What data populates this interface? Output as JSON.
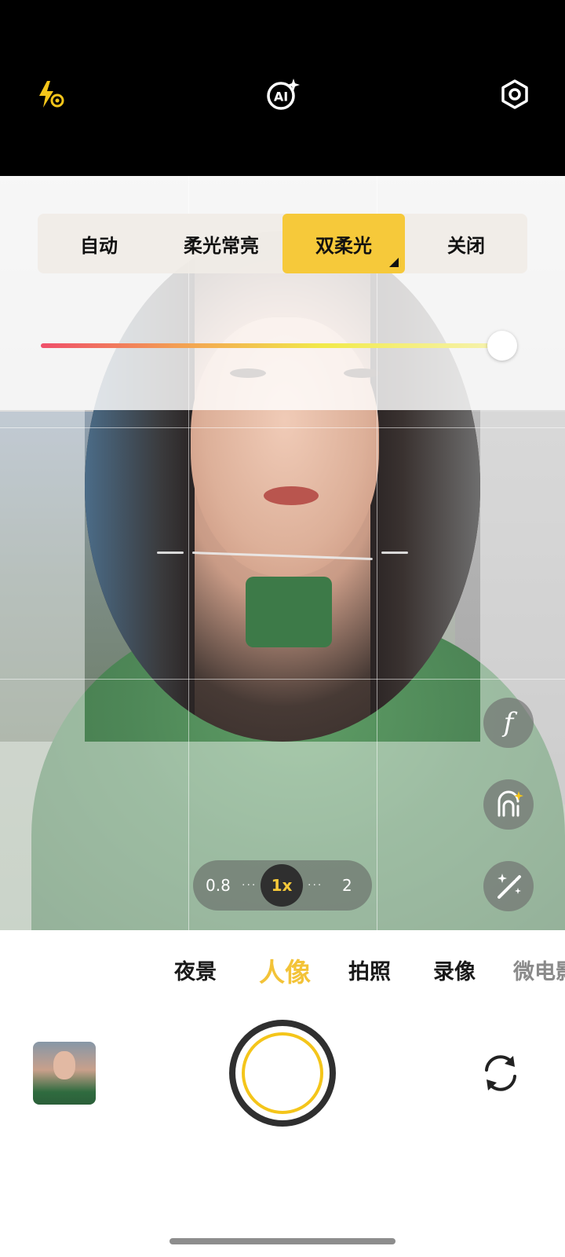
{
  "status": {
    "flash_icon": "flash-auto-icon",
    "ai_icon": "ai-sparkle-icon",
    "settings_icon": "gear-hex-icon"
  },
  "light_modes": {
    "items": [
      {
        "label": "自动"
      },
      {
        "label": "柔光常亮"
      },
      {
        "label": "双柔光"
      },
      {
        "label": "关闭"
      }
    ],
    "selected": "双柔光"
  },
  "intensity_slider": {
    "value": 0.98
  },
  "side_tools": {
    "filter_label": "f",
    "icons": [
      "filter-icon",
      "ai-portrait-icon",
      "magic-wand-icon"
    ]
  },
  "zoom": {
    "options": [
      "0.8",
      "1x",
      "2"
    ],
    "current": "1x"
  },
  "camera_modes": {
    "items": [
      {
        "label": "夜景"
      },
      {
        "label": "人像"
      },
      {
        "label": "拍照"
      },
      {
        "label": "录像"
      },
      {
        "label": "微电影"
      }
    ],
    "active": "人像"
  },
  "colors": {
    "accent": "#f6c93a",
    "shutter_ring": "#f4c51a"
  }
}
